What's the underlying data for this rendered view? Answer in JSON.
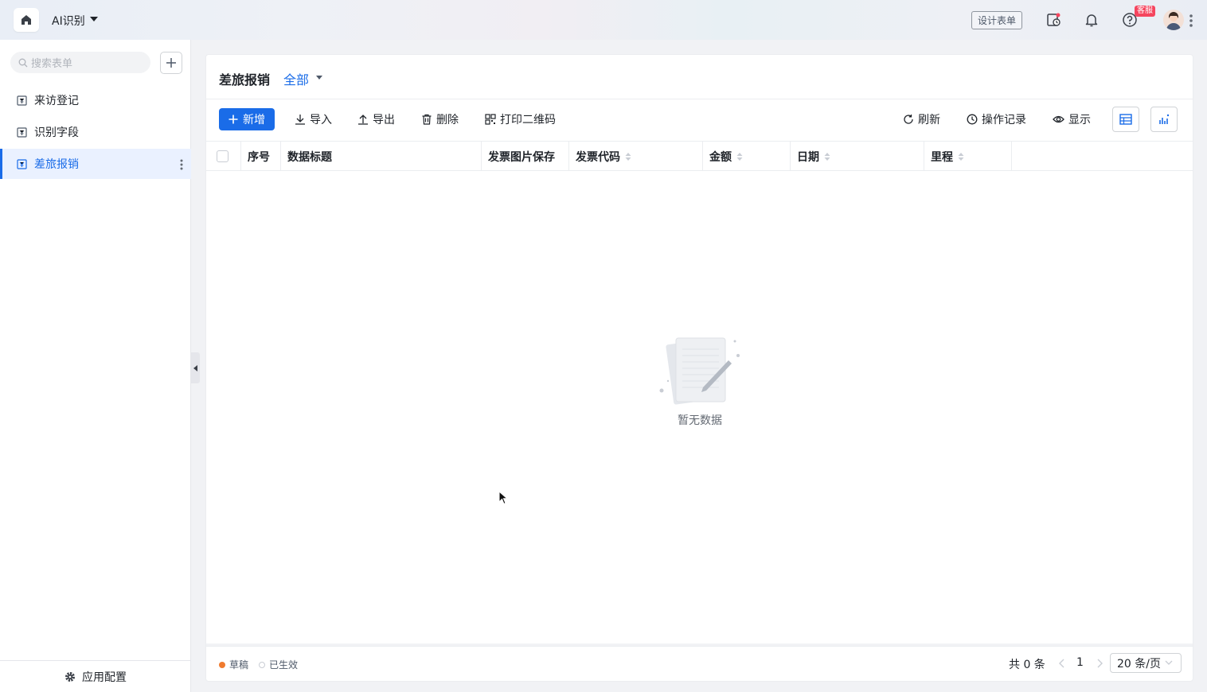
{
  "topbar": {
    "app_name": "AI识别",
    "design_form_label": "设计表单",
    "customer_service_badge": "客服"
  },
  "sidebar": {
    "search_placeholder": "搜索表单",
    "items": [
      {
        "label": "来访登记",
        "active": false
      },
      {
        "label": "识别字段",
        "active": false
      },
      {
        "label": "差旅报销",
        "active": true
      }
    ],
    "footer_label": "应用配置"
  },
  "main": {
    "title": "差旅报销",
    "filter_label": "全部",
    "toolbar": {
      "add_label": "新增",
      "import_label": "导入",
      "export_label": "导出",
      "delete_label": "删除",
      "print_qr_label": "打印二维码",
      "refresh_label": "刷新",
      "oplog_label": "操作记录",
      "display_label": "显示"
    },
    "table": {
      "columns": [
        "序号",
        "数据标题",
        "发票图片保存",
        "发票代码",
        "金额",
        "日期",
        "里程"
      ],
      "rows": [],
      "empty_text": "暂无数据"
    },
    "footer": {
      "legend_draft": "草稿",
      "legend_effective": "已生效",
      "total_text": "共 0 条",
      "current_page": "1",
      "page_size": "20 条/页"
    }
  },
  "colors": {
    "accent": "#1a6ce8",
    "draft_dot": "#f07b2f",
    "badge": "#f5455e"
  }
}
